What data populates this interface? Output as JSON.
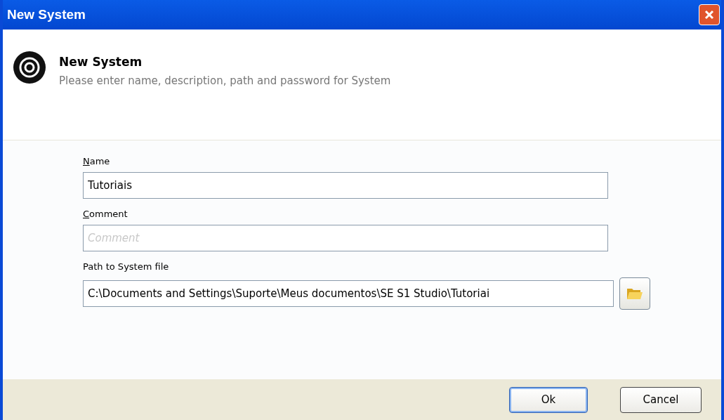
{
  "window": {
    "title": "New System"
  },
  "header": {
    "title": "New System",
    "subtitle": "Please enter name, description, path and password for System"
  },
  "fields": [
    {
      "kind": "text",
      "label": "Name",
      "mnemonic_underlined": true,
      "value": "Tutoriais"
    },
    {
      "kind": "text",
      "label": "Comment",
      "mnemonic_underlined": true,
      "placeholder": "Comment"
    },
    {
      "kind": "browse",
      "label": "Path to System file",
      "mnemonic_underlined": false,
      "value": "C:\\Documents and Settings\\Suporte\\Meus documentos\\SE S1 Studio\\Tutoriai"
    }
  ],
  "buttons": [
    {
      "label": "Ok",
      "default": true
    },
    {
      "label": "Cancel",
      "default": false
    }
  ]
}
